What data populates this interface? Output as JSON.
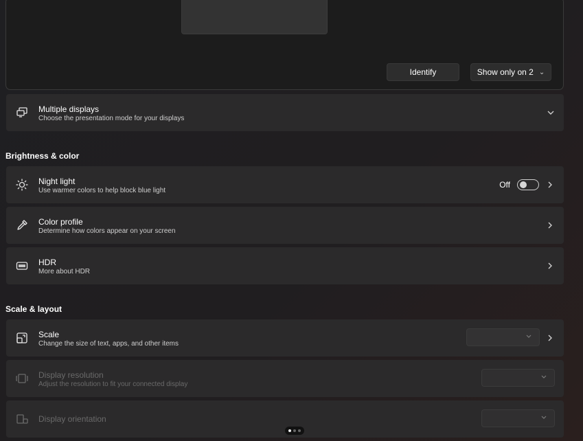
{
  "preview": {
    "identify_label": "Identify",
    "show_only_label": "Show only on 2"
  },
  "multiple_displays": {
    "title": "Multiple displays",
    "subtitle": "Choose the presentation mode for your displays"
  },
  "section_brightness": "Brightness & color",
  "night_light": {
    "title": "Night light",
    "subtitle": "Use warmer colors to help block blue light",
    "state_label": "Off"
  },
  "color_profile": {
    "title": "Color profile",
    "subtitle": "Determine how colors appear on your screen"
  },
  "hdr": {
    "title": "HDR",
    "subtitle": "More about HDR"
  },
  "section_scale": "Scale & layout",
  "scale": {
    "title": "Scale",
    "subtitle": "Change the size of text, apps, and other items"
  },
  "display_resolution": {
    "title": "Display resolution",
    "subtitle": "Adjust the resolution to fit your connected display"
  },
  "display_orientation": {
    "title": "Display orientation"
  },
  "pager": {
    "pages": 3,
    "active": 1
  }
}
